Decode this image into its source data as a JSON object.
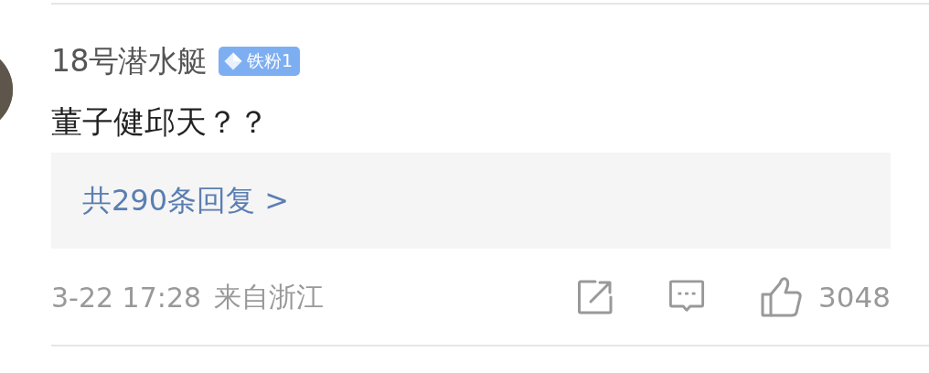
{
  "comment": {
    "username": "18号潜水艇",
    "badge": "铁粉1",
    "text": "董子健邱天？？",
    "replies": "共290条回复 >",
    "time": "3-22 17:28",
    "location": "来自浙江",
    "likes": "3048"
  }
}
